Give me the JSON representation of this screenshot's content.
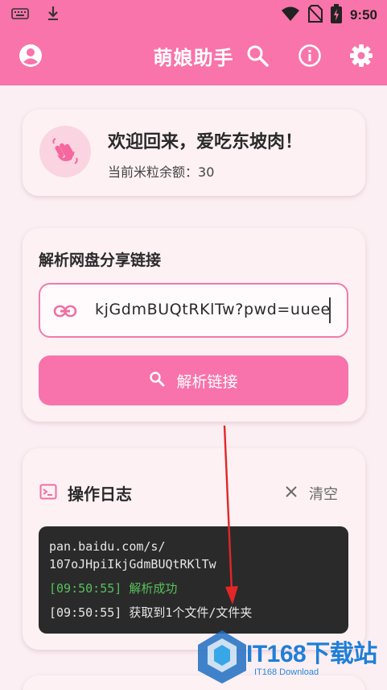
{
  "status_bar": {
    "time": "9:50",
    "icons": [
      "keyboard-icon",
      "download-icon",
      "wifi-icon",
      "no-sim-icon",
      "battery-charging-icon"
    ]
  },
  "app_bar": {
    "title": "萌娘助手",
    "icons": [
      "account-icon",
      "search-icon",
      "info-icon",
      "settings-icon"
    ]
  },
  "welcome": {
    "greeting": "欢迎回来，爱吃东坡肉！",
    "balance_label": "当前米粒余额：",
    "balance_value": "30",
    "icon": "waving-hand-icon"
  },
  "parse": {
    "title": "解析网盘分享链接",
    "input_value": "kjGdmBUQtRKlTw?pwd=uuee",
    "input_icon": "link-icon",
    "button_label": "解析链接",
    "button_icon": "search-icon"
  },
  "log": {
    "title": "操作日志",
    "title_icon": "terminal-icon",
    "clear_label": "清空",
    "lines": [
      "pan.baidu.com/s/",
      "107oJHpiIkjGdmBUQtRKlTw",
      "[09:50:55] 解析成功",
      "[09:50:55] 获取到1个文件/文件夹"
    ]
  },
  "watermark": {
    "brand": "IT168下载站",
    "sub": "IT168 Download"
  },
  "colors": {
    "primary": "#f874aa",
    "background": "#fbeff3",
    "card": "#fdf1f4",
    "terminal": "#2a2a2a",
    "success": "#58c05c",
    "arrow": "#e32626"
  }
}
